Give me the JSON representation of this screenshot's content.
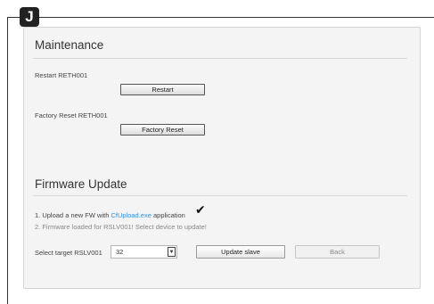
{
  "tag": {
    "letter": "J"
  },
  "maintenance": {
    "title": "Maintenance",
    "restart_label": "Restart RETH001",
    "restart_button": "Restart",
    "factory_label": "Factory Reset RETH001",
    "factory_button": "Factory Reset"
  },
  "firmware": {
    "title": "Firmware Update",
    "step1_prefix": "1. Upload a new FW with ",
    "step1_link": "CfUpload.exe",
    "step1_suffix": " application",
    "step2": "2. Firmware loaded for RSLV001! Select device to update!",
    "select_label": "Select target RSLV001",
    "select_value": "32",
    "update_button": "Update slave",
    "back_button": "Back"
  },
  "icons": {
    "check": "✔",
    "dropdown": "▼"
  }
}
